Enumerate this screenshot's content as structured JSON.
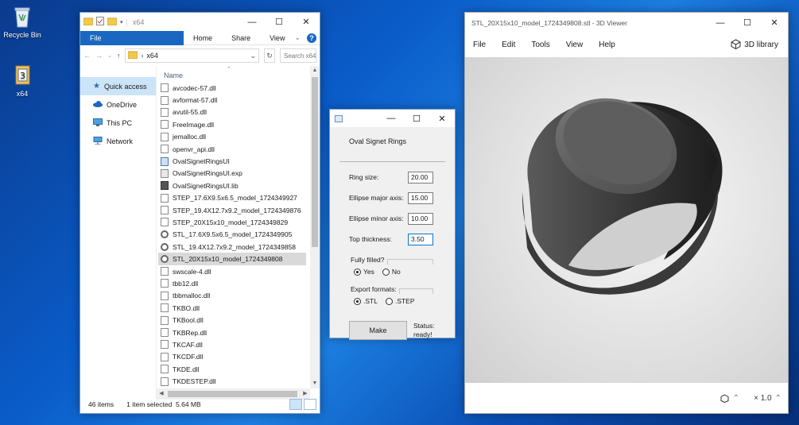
{
  "desktop": {
    "icons": [
      {
        "label": "Recycle Bin",
        "icon": "recycle-bin-icon"
      },
      {
        "label": "x64",
        "icon": "installer-icon"
      }
    ]
  },
  "explorer": {
    "title": "x64",
    "ribbon_tabs": [
      "File",
      "Home",
      "Share",
      "View"
    ],
    "address": "x64",
    "search_placeholder": "Search x64",
    "nav": [
      {
        "label": "Quick access",
        "icon": "star-icon"
      },
      {
        "label": "OneDrive",
        "icon": "cloud-icon"
      },
      {
        "label": "This PC",
        "icon": "computer-icon"
      },
      {
        "label": "Network",
        "icon": "network-icon"
      }
    ],
    "column_name": "Name",
    "files": [
      {
        "name": "avcodec-57.dll",
        "type": "dll"
      },
      {
        "name": "avformat-57.dll",
        "type": "dll"
      },
      {
        "name": "avutil-55.dll",
        "type": "dll"
      },
      {
        "name": "FreeImage.dll",
        "type": "dll"
      },
      {
        "name": "jemalloc.dll",
        "type": "dll"
      },
      {
        "name": "openvr_api.dll",
        "type": "dll"
      },
      {
        "name": "OvalSignetRingsUI",
        "type": "app"
      },
      {
        "name": "OvalSignetRingsUI.exp",
        "type": "exp"
      },
      {
        "name": "OvalSignetRingsUI.lib",
        "type": "lib"
      },
      {
        "name": "STEP_17.6X9.5x6.5_model_1724349927",
        "type": "step"
      },
      {
        "name": "STEP_19.4X12.7x9.2_model_1724349876",
        "type": "step"
      },
      {
        "name": "STEP_20X15x10_model_1724349829",
        "type": "step"
      },
      {
        "name": "STL_17.6X9.5x6.5_model_1724349905",
        "type": "stl"
      },
      {
        "name": "STL_19.4X12.7x9.2_model_1724349858",
        "type": "stl"
      },
      {
        "name": "STL_20X15x10_model_1724349808",
        "type": "stl",
        "selected": true
      },
      {
        "name": "swscale-4.dll",
        "type": "dll"
      },
      {
        "name": "tbb12.dll",
        "type": "dll"
      },
      {
        "name": "tbbmalloc.dll",
        "type": "dll"
      },
      {
        "name": "TKBO.dll",
        "type": "dll"
      },
      {
        "name": "TKBool.dll",
        "type": "dll"
      },
      {
        "name": "TKBRep.dll",
        "type": "dll"
      },
      {
        "name": "TKCAF.dll",
        "type": "dll"
      },
      {
        "name": "TKCDF.dll",
        "type": "dll"
      },
      {
        "name": "TKDE.dll",
        "type": "dll"
      },
      {
        "name": "TKDESTEP.dll",
        "type": "dll"
      }
    ],
    "status_items": "46 items",
    "status_selected": "1 item selected  5.64 MB"
  },
  "dialog": {
    "heading": "Oval Signet Rings",
    "fields": [
      {
        "label": "Ring size:",
        "value": "20.00"
      },
      {
        "label": "Ellipse major axis:",
        "value": "15.00"
      },
      {
        "label": "Ellipse minor axis:",
        "value": "10.00"
      },
      {
        "label": "Top thickness:",
        "value": "3.50"
      }
    ],
    "filled_group": "Fully filled?",
    "filled_options": [
      "Yes",
      "No"
    ],
    "filled_selected": "Yes",
    "export_group": "Export formats:",
    "export_options": [
      ".STL",
      ".STEP"
    ],
    "export_selected": ".STL",
    "make_label": "Make",
    "status_label": "Status:",
    "status_value": "ready!"
  },
  "viewer": {
    "title": "STL_20X15x10_model_1724349808.stl - 3D Viewer",
    "menu": [
      "File",
      "Edit",
      "Tools",
      "View",
      "Help"
    ],
    "library_label": "3D library",
    "zoom_label": "× 1.0"
  }
}
